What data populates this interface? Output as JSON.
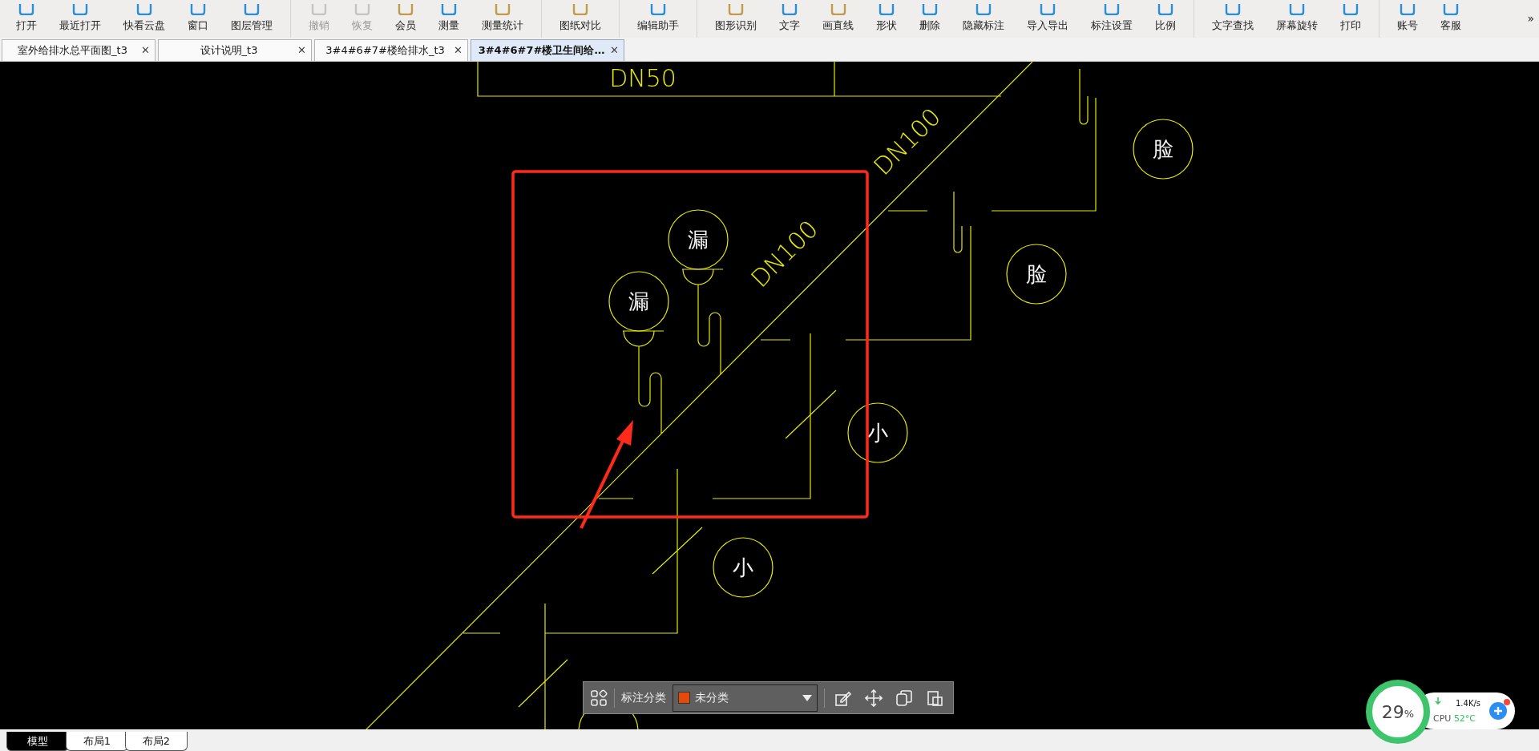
{
  "toolbar": {
    "groups": [
      [
        {
          "label": "打开",
          "disabled": false,
          "color": "#2a8fd9"
        },
        {
          "label": "最近打开",
          "disabled": false,
          "color": "#2a8fd9"
        },
        {
          "label": "快看云盘",
          "disabled": false,
          "color": "#2a8fd9"
        },
        {
          "label": "窗口",
          "disabled": false,
          "color": "#2a8fd9"
        },
        {
          "label": "图层管理",
          "disabled": false,
          "color": "#2a8fd9"
        }
      ],
      [
        {
          "label": "撤销",
          "disabled": true,
          "color": "#c4c4c4"
        },
        {
          "label": "恢复",
          "disabled": true,
          "color": "#c4c4c4"
        },
        {
          "label": "会员",
          "disabled": false,
          "color": "#c39b4a"
        },
        {
          "label": "测量",
          "disabled": false,
          "color": "#2a8fd9"
        },
        {
          "label": "测量统计",
          "disabled": false,
          "color": "#c39b4a"
        }
      ],
      [
        {
          "label": "图纸对比",
          "disabled": false,
          "color": "#c39b4a"
        }
      ],
      [
        {
          "label": "编辑助手",
          "disabled": false,
          "color": "#2a8fd9"
        }
      ],
      [
        {
          "label": "图形识别",
          "disabled": false,
          "color": "#c39b4a"
        },
        {
          "label": "文字",
          "disabled": false,
          "color": "#2a8fd9"
        },
        {
          "label": "画直线",
          "disabled": false,
          "color": "#c39b4a"
        },
        {
          "label": "形状",
          "disabled": false,
          "color": "#2a8fd9"
        },
        {
          "label": "删除",
          "disabled": false,
          "color": "#2a8fd9"
        },
        {
          "label": "隐藏标注",
          "disabled": false,
          "color": "#2a8fd9"
        },
        {
          "label": "导入导出",
          "disabled": false,
          "color": "#2a8fd9"
        },
        {
          "label": "标注设置",
          "disabled": false,
          "color": "#2a8fd9"
        },
        {
          "label": "比例",
          "disabled": false,
          "color": "#2a8fd9"
        }
      ],
      [
        {
          "label": "文字查找",
          "disabled": false,
          "color": "#2a8fd9"
        },
        {
          "label": "屏幕旋转",
          "disabled": false,
          "color": "#2a8fd9"
        },
        {
          "label": "打印",
          "disabled": false,
          "color": "#2a8fd9"
        }
      ],
      [
        {
          "label": "账号",
          "disabled": false,
          "color": "#2a8fd9"
        },
        {
          "label": "客服",
          "disabled": false,
          "color": "#2a8fd9"
        }
      ]
    ],
    "overflow": "»"
  },
  "tabs": [
    {
      "label": "室外给排水总平面图_t3",
      "selected": false,
      "close": "✕"
    },
    {
      "label": "设计说明_t3",
      "selected": false,
      "close": "✕"
    },
    {
      "label": "3#4#6#7#楼给排水_t3",
      "selected": false,
      "close": "✕"
    },
    {
      "label": "3#4#6#7#楼卫生间给…",
      "selected": true,
      "close": "✕"
    }
  ],
  "drawing": {
    "pipe_labels": [
      {
        "text": "DN50"
      },
      {
        "text": "DN100"
      },
      {
        "text": "DN100"
      }
    ],
    "fixture_labels": [
      {
        "text": "漏"
      },
      {
        "text": "漏"
      },
      {
        "text": "脸"
      },
      {
        "text": "脸"
      },
      {
        "text": "小"
      },
      {
        "text": "小"
      }
    ]
  },
  "annotation_bar": {
    "label": "标注分类",
    "category": {
      "text": "未分类",
      "color": "#e64a0a"
    }
  },
  "monitor": {
    "percent": "29",
    "unit": "%",
    "speed": "1.4K/s",
    "cpu_label": "CPU",
    "cpu_temp": "52°C"
  },
  "layout_tabs": [
    {
      "label": "模型",
      "selected": true
    },
    {
      "label": "布局1",
      "selected": false
    },
    {
      "label": "布局2",
      "selected": false
    }
  ]
}
